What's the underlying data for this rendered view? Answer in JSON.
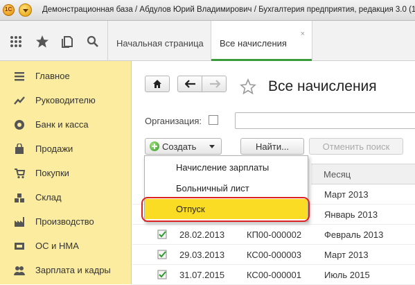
{
  "window": {
    "title": "Демонстрационная база / Абдулов Юрий Владимирович / Бухгалтерия предприятия, редакция 3.0  (1С:Пр",
    "logo_icon": "1c-logo-icon",
    "menu_icon": "main-menu-icon"
  },
  "toolbar": {
    "icons": [
      "apps-grid-icon",
      "favorites-star-icon",
      "history-icon",
      "search-icon"
    ],
    "tabs": [
      {
        "label": "Начальная страница",
        "active": false
      },
      {
        "label": "Все начисления",
        "active": true,
        "close": "×"
      }
    ]
  },
  "sidebar": {
    "background": "#fbeca0",
    "items": [
      {
        "label": "Главное",
        "icon": "list-icon"
      },
      {
        "label": "Руководителю",
        "icon": "trend-chart-icon"
      },
      {
        "label": "Банк и касса",
        "icon": "coins-icon"
      },
      {
        "label": "Продажи",
        "icon": "shopping-bag-icon"
      },
      {
        "label": "Покупки",
        "icon": "shopping-cart-icon"
      },
      {
        "label": "Склад",
        "icon": "warehouse-icon"
      },
      {
        "label": "Производство",
        "icon": "factory-icon"
      },
      {
        "label": "ОС и НМА",
        "icon": "assets-icon"
      },
      {
        "label": "Зарплата и кадры",
        "icon": "people-icon"
      }
    ]
  },
  "main": {
    "title": "Все начисления",
    "organization_label": "Организация:",
    "create_label": "Создать",
    "find_label": "Найти...",
    "cancel_search_label": "Отменить поиск",
    "column_month": "Месяц",
    "rows": [
      {
        "date": "",
        "number": "",
        "month": "Март 2013"
      },
      {
        "date": "",
        "number": "",
        "month": "Январь 2013"
      },
      {
        "date": "28.02.2013",
        "number": "КП00-000002",
        "month": "Февраль 2013"
      },
      {
        "date": "29.03.2013",
        "number": "КС00-000003",
        "month": "Март 2013"
      },
      {
        "date": "31.07.2015",
        "number": "КС00-000001",
        "month": "Июль 2015"
      }
    ]
  },
  "dropdown": {
    "items": [
      {
        "label": "Начисление зарплаты",
        "selected": false
      },
      {
        "label": "Больничный лист",
        "selected": false
      },
      {
        "label": "Отпуск",
        "selected": true
      }
    ],
    "selected_color": "#fbdc24",
    "highlight_color": "#dd2222"
  }
}
